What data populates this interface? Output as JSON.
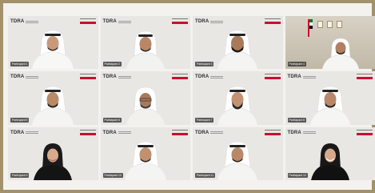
{
  "screenshot": {
    "title": ""
  },
  "brand": {
    "logo_text": "TDRA",
    "accent_color": "#c8102e",
    "frame_color": "#a3916b"
  },
  "participants": [
    {
      "logo": "TDRA",
      "name": "Participant 1",
      "attire": "white"
    },
    {
      "logo": "TDRA",
      "name": "Participant 2",
      "attire": "white"
    },
    {
      "logo": "TDRA",
      "name": "Participant 3",
      "attire": "white"
    },
    {
      "logo": "",
      "name": "Participant 4",
      "attire": "dark-office"
    },
    {
      "logo": "TDRA",
      "name": "Participant 5",
      "attire": "white"
    },
    {
      "logo": "TDRA",
      "name": "Participant 6",
      "attire": "white"
    },
    {
      "logo": "TDRA",
      "name": "Participant 7",
      "attire": "white"
    },
    {
      "logo": "TDRA",
      "name": "Participant 8",
      "attire": "white"
    },
    {
      "logo": "TDRA",
      "name": "Participant 9",
      "attire": "black"
    },
    {
      "logo": "TDRA",
      "name": "Participant 10",
      "attire": "white"
    },
    {
      "logo": "TDRA",
      "name": "Participant 11",
      "attire": "white"
    },
    {
      "logo": "TDRA",
      "name": "Participant 12",
      "attire": "black"
    }
  ]
}
